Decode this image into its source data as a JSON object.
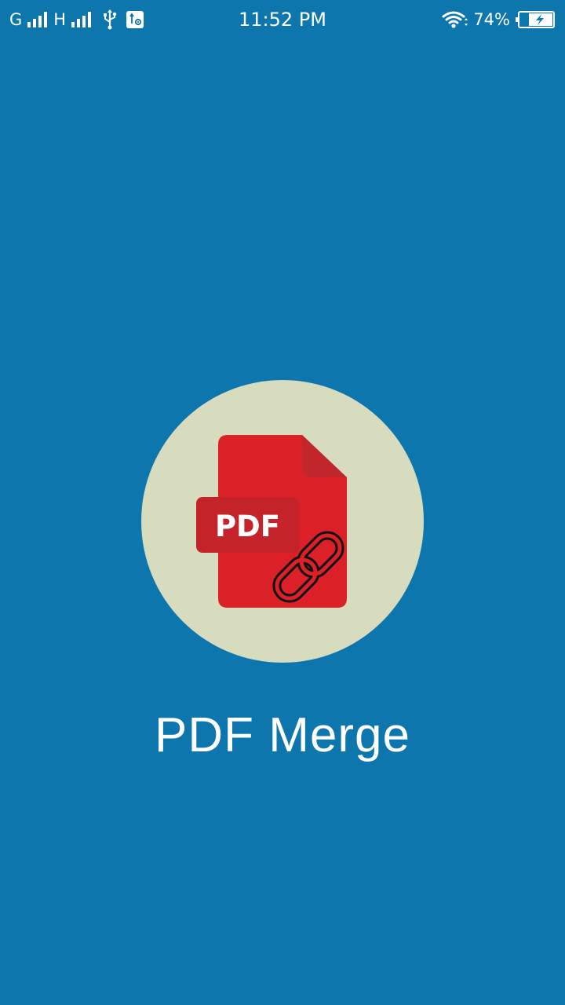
{
  "colors": {
    "background": "#0D77AD",
    "circle": "#D8DCBE",
    "document_red": "#DB2127",
    "label_red": "#C4232A",
    "fold_red": "#C1262C",
    "chain": "#111111",
    "text": "#FFFFFF"
  },
  "status_bar": {
    "network_1": "G",
    "network_2": "H",
    "time": "11:52 PM",
    "battery": "74%",
    "icons": [
      "signal-icon",
      "usb-icon",
      "debug-icon",
      "wifi-icon",
      "battery-icon"
    ]
  },
  "splash": {
    "logo_label": "PDF",
    "logo_icon": "pdf-merge-icon",
    "title": "PDF Merge"
  }
}
